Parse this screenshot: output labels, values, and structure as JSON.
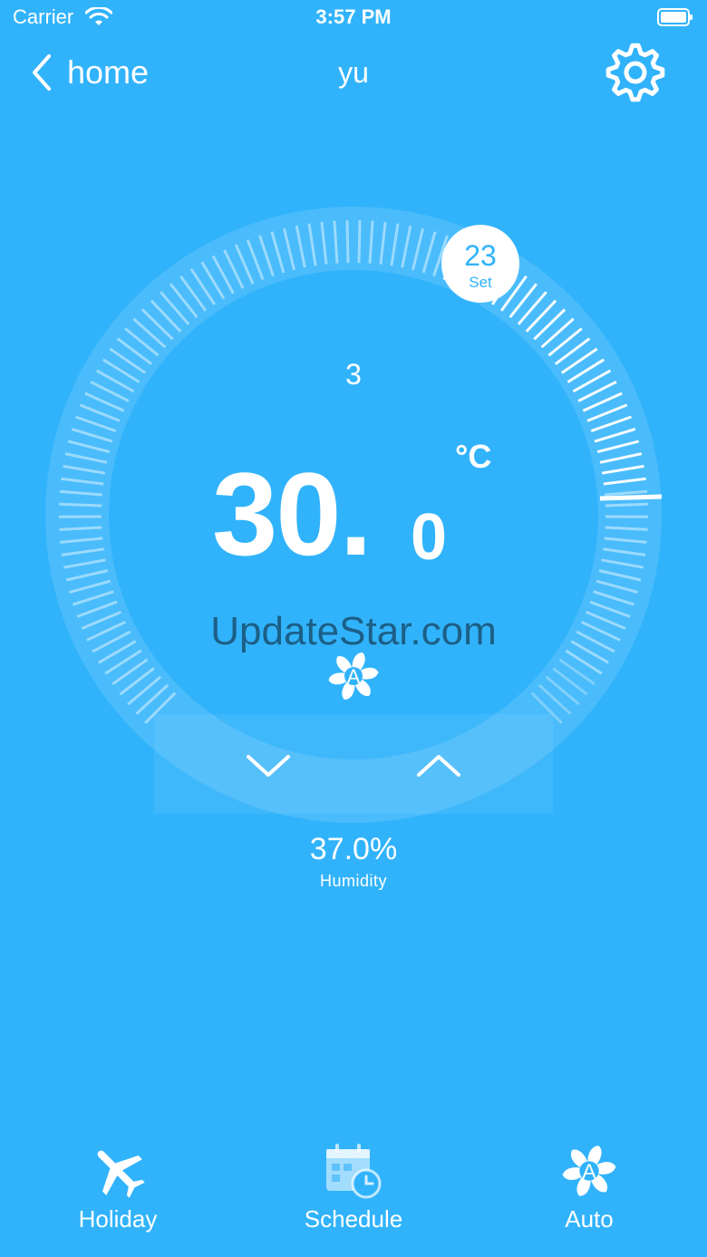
{
  "status_bar": {
    "carrier": "Carrier",
    "time": "3:57 PM"
  },
  "nav": {
    "back_label": "home",
    "title": "yu"
  },
  "thermostat": {
    "set_value": "23",
    "set_label": "Set",
    "mode_number": "3",
    "temp_integer": "30.",
    "temp_decimal": "0",
    "unit": "°C",
    "current_temp_c": 30.0,
    "set_temp_c": 23
  },
  "watermark": "UpdateStar.com",
  "humidity": {
    "value": "37.0%",
    "label": "Humidity"
  },
  "tabs": [
    {
      "label": "Holiday",
      "icon": "airplane-icon"
    },
    {
      "label": "Schedule",
      "icon": "calendar-clock-icon"
    },
    {
      "label": "Auto",
      "icon": "auto-fan-icon"
    }
  ],
  "colors": {
    "background": "#31b3fb",
    "foreground": "#ffffff",
    "watermark": "#1c5f86"
  }
}
